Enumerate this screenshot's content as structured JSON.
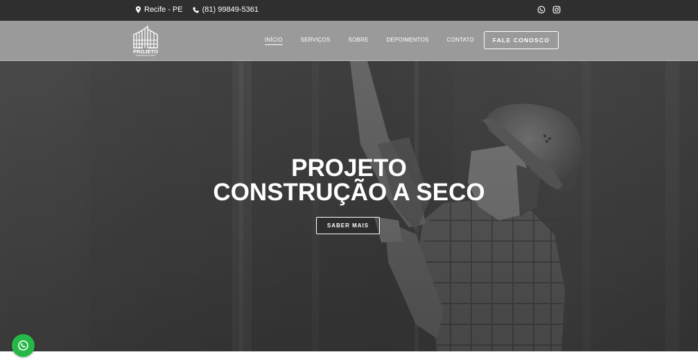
{
  "topbar": {
    "location": "Recife - PE",
    "phone": "(81) 99849-5361",
    "icons": [
      "map-pin-icon",
      "phone-icon",
      "whatsapp-icon",
      "instagram-icon"
    ]
  },
  "header": {
    "logo_text": "PROJETO",
    "logo_subtext": "CONSTRUÇÃO A SECO",
    "nav": [
      {
        "label": "INÍCIO",
        "active": true
      },
      {
        "label": "SERVIÇOS",
        "active": false
      },
      {
        "label": "SOBRE",
        "active": false
      },
      {
        "label": "DEPOIMENTOS",
        "active": false
      },
      {
        "label": "CONTATO",
        "active": false
      }
    ],
    "cta_label": "FALE CONOSCO"
  },
  "hero": {
    "title_line1": "PROJETO",
    "title_line2": "CONSTRUÇÃO A SECO",
    "button_label": "SABER MAIS"
  },
  "floating": {
    "icon": "whatsapp-icon"
  },
  "colors": {
    "topbar_bg": "#2f2f2f",
    "header_bg": "#9a9a9a",
    "whatsapp_green": "#25b847"
  }
}
